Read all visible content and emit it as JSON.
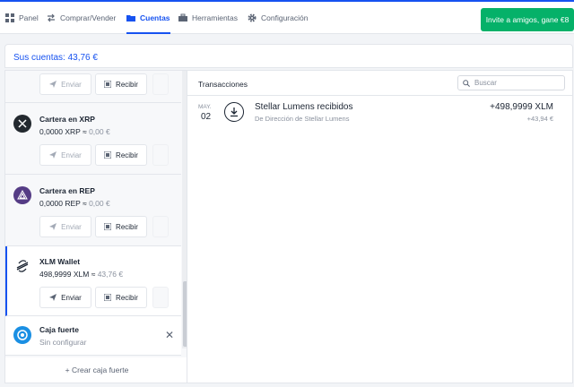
{
  "nav": {
    "items": [
      {
        "label": "Panel",
        "icon": "dashboard-icon"
      },
      {
        "label": "Comprar/Vender",
        "icon": "swap-arrows-icon"
      },
      {
        "label": "Cuentas",
        "icon": "folder-icon",
        "active": true
      },
      {
        "label": "Herramientas",
        "icon": "toolbox-icon"
      },
      {
        "label": "Configuración",
        "icon": "gear-icon"
      }
    ],
    "invite_label": "Invite a amigos, gane €8"
  },
  "accounts": {
    "title": "Sus cuentas: 43,76 €"
  },
  "wallets": [
    {
      "name": "",
      "balance": "",
      "fiat": "",
      "send_label": "Enviar",
      "receive_label": "Recibir",
      "send_disabled": true
    },
    {
      "name": "Cartera en XRP",
      "balance": "0,0000 XRP ≈ ",
      "fiat": "0,00 €",
      "send_label": "Enviar",
      "receive_label": "Recibir",
      "send_disabled": true,
      "icon": "xrp-icon",
      "color": "#23292f"
    },
    {
      "name": "Cartera en REP",
      "balance": "0,0000 REP ≈ ",
      "fiat": "0,00 €",
      "send_label": "Enviar",
      "receive_label": "Recibir",
      "send_disabled": true,
      "icon": "rep-icon",
      "color": "#553c85"
    },
    {
      "name": "XLM Wallet",
      "balance": "498,9999 XLM ≈ ",
      "fiat": "43,76 €",
      "send_label": "Enviar",
      "receive_label": "Recibir",
      "send_disabled": false,
      "icon": "xlm-icon",
      "color": "#1c2533",
      "active": true
    }
  ],
  "vault": {
    "name": "Caja fuerte",
    "status": "Sin configurar",
    "icon": "vault-icon",
    "color": "#1a8fe3"
  },
  "create_vault_label": "+ Crear caja fuerte",
  "transactions": {
    "title": "Transacciones",
    "search_placeholder": "Buscar",
    "rows": [
      {
        "month": "MAY.",
        "day": "02",
        "name": "Stellar Lumens recibidos",
        "subtitle": "De Dirección de Stellar Lumens",
        "amount": "+498,9999 XLM",
        "fiat": "+43,94 €",
        "icon": "download-icon"
      }
    ]
  },
  "colors": {
    "accent": "#1652f0",
    "invite": "#05b169"
  }
}
